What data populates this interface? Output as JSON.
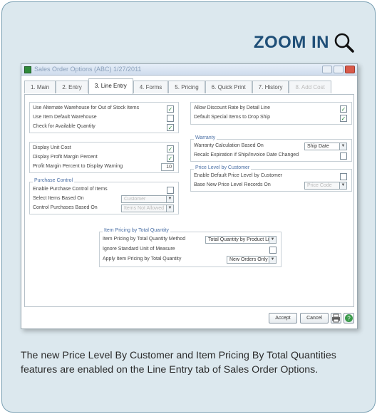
{
  "zoom_label": "ZOOM IN",
  "window": {
    "title": "Sales Order Options (ABC) 1/27/2011"
  },
  "tabs": [
    {
      "label": "1. Main",
      "state": "normal"
    },
    {
      "label": "2. Entry",
      "state": "normal"
    },
    {
      "label": "3. Line Entry",
      "state": "active"
    },
    {
      "label": "4. Forms",
      "state": "normal"
    },
    {
      "label": "5. Pricing",
      "state": "normal"
    },
    {
      "label": "6. Quick Print",
      "state": "normal"
    },
    {
      "label": "7. History",
      "state": "normal"
    },
    {
      "label": "8. Add Cost",
      "state": "disabled"
    }
  ],
  "left_options": [
    {
      "label": "Use Alternate Warehouse for Out of Stock Items",
      "checked": true
    },
    {
      "label": "Use Item Default Warehouse",
      "checked": false
    },
    {
      "label": "Check for Available Quantity",
      "checked": true
    }
  ],
  "cost_options": [
    {
      "label": "Display Unit Cost",
      "checked": true
    },
    {
      "label": "Display Profit Margin Percent",
      "checked": true
    }
  ],
  "profit_warning": {
    "label": "Profit Margin Percent to Display Warning",
    "value": "10"
  },
  "right_options": [
    {
      "label": "Allow Discount Rate by Detail Line",
      "checked": true
    },
    {
      "label": "Default Special Items to Drop Ship",
      "checked": true
    }
  ],
  "purchase_control": {
    "title": "Purchase Control",
    "enable_label": "Enable Purchase Control of Items",
    "enable_checked": false,
    "select_label": "Select Items Based On",
    "select_value": "Customer",
    "control_label": "Control Purchases Based On",
    "control_value": "Items Not Allowed"
  },
  "warranty": {
    "title": "Warranty",
    "calc_label": "Warranty Calculation Based On",
    "calc_value": "Ship Date",
    "recalc_label": "Recalc Expiration if Ship/Invoice Date Changed",
    "recalc_checked": false
  },
  "price_level": {
    "title": "Price Level by Customer",
    "enable_label": "Enable Default Price Level by Customer",
    "enable_checked": false,
    "base_label": "Base New Price Level Records On",
    "base_value": "Price Code"
  },
  "item_pricing": {
    "title": "Item Pricing by Total Quantity",
    "method_label": "Item Pricing by Total Quantity Method",
    "method_value": "Total Quantity by Product Line",
    "ignore_label": "Ignore Standard Unit of Measure",
    "ignore_checked": false,
    "apply_label": "Apply Item Pricing by Total Quantity",
    "apply_value": "New Orders Only"
  },
  "buttons": {
    "accept": "Accept",
    "cancel": "Cancel"
  },
  "caption": "The new Price Level By Customer and Item Pricing By Total Quantities features are enabled on the Line Entry tab of Sales Order Options."
}
